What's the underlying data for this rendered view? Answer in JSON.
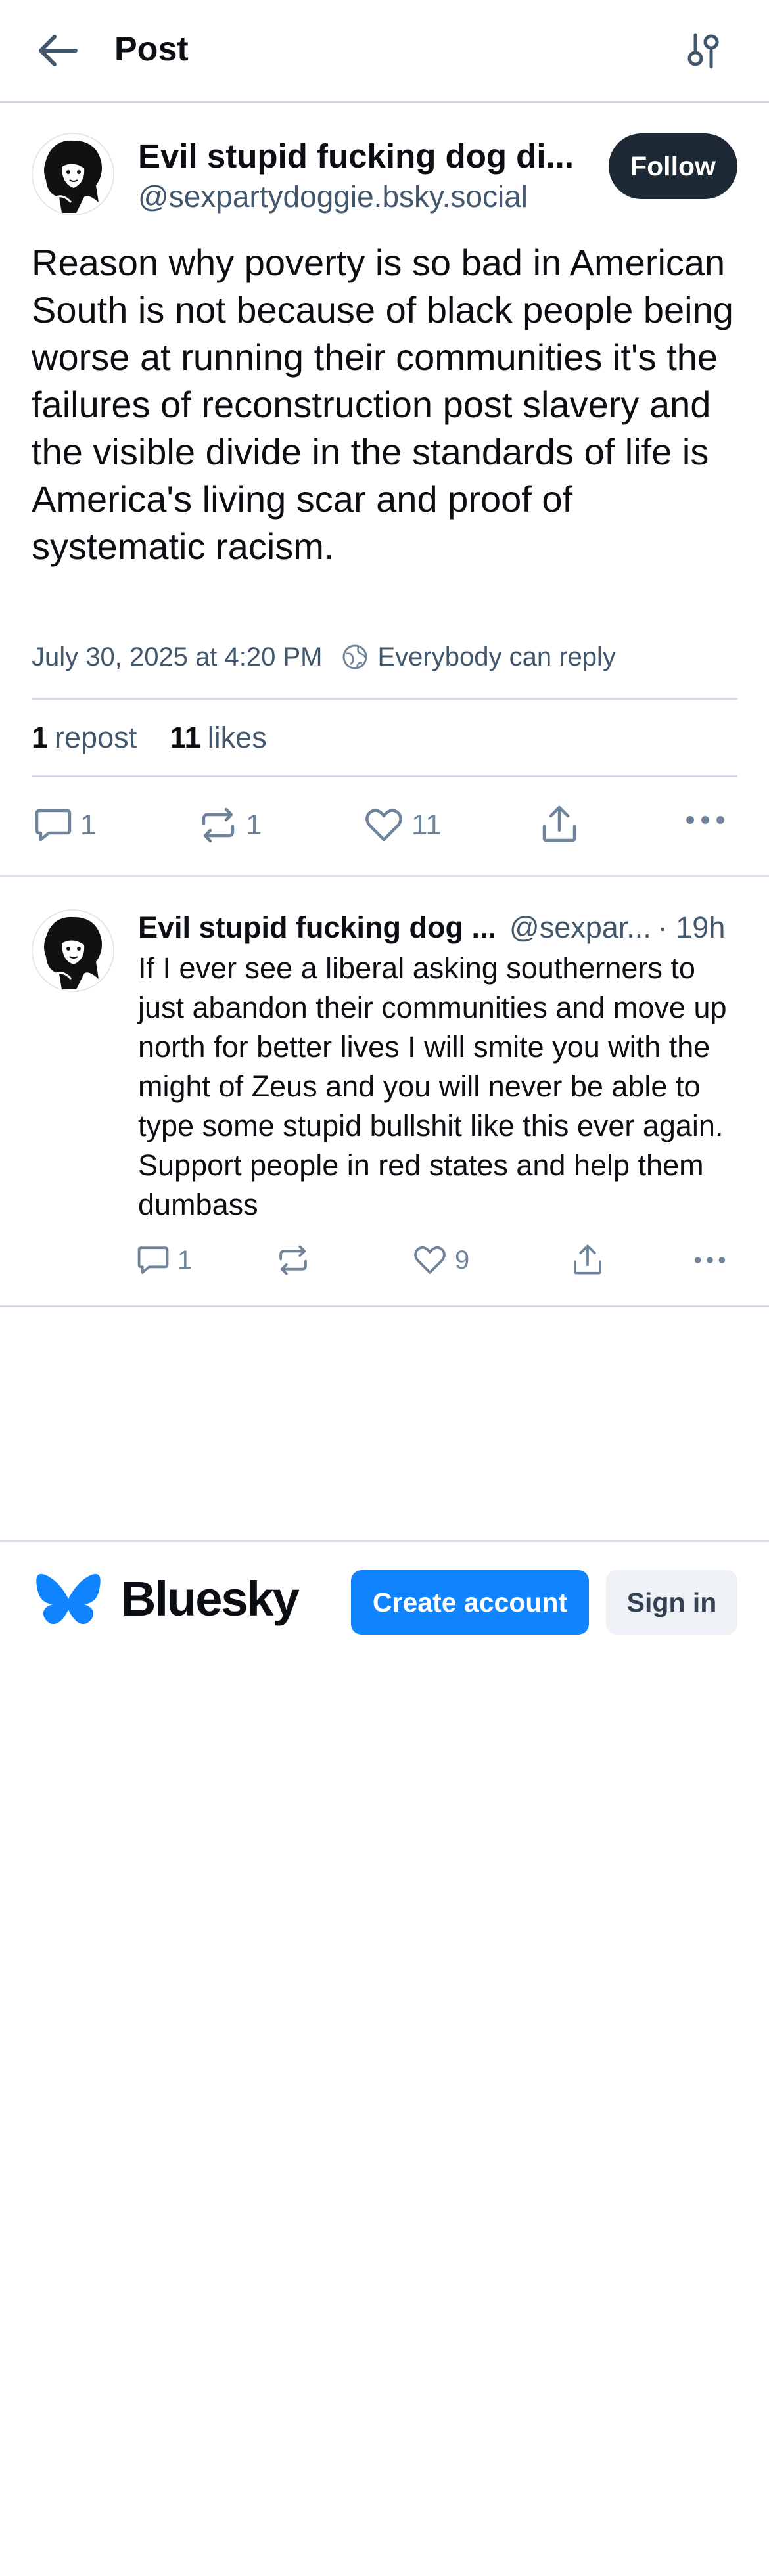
{
  "header": {
    "title": "Post",
    "back_icon": "arrow-left-icon",
    "filter_icon": "sliders-icon"
  },
  "post": {
    "author_name": "Evil stupid fucking dog di...",
    "author_handle": "@sexpartydoggie.bsky.social",
    "follow_label": "Follow",
    "text": "Reason why poverty is so bad in American South is not because of black people being worse at running their communities it's the failures of reconstruction post slavery and the visible divide in the standards of life is America's living scar and proof of systematic racism.",
    "timestamp": "July 30, 2025 at 4:20 PM",
    "reply_setting": "Everybody can reply",
    "reposts_count": "1",
    "reposts_label": "repost",
    "likes_count": "11",
    "likes_label": "likes",
    "actions": {
      "replies": "1",
      "reposts": "1",
      "likes": "11"
    }
  },
  "reply": {
    "author_name": "Evil stupid fucking dog ...",
    "author_handle": "@sexpar...",
    "time": "· 19h",
    "text": "If I ever see a liberal asking southerners to just abandon their communities and move up north for better lives I will smite you with the might of Zeus and you will never be able to type some stupid bullshit like this ever again. Support people in red states and help them dumbass",
    "actions": {
      "replies": "1",
      "reposts": "",
      "likes": "9"
    }
  },
  "footer": {
    "brand": "Bluesky",
    "create_account_label": "Create account",
    "sign_in_label": "Sign in"
  },
  "colors": {
    "accent": "#1083fe",
    "follow_bg": "#1e2936",
    "muted_text": "#42576c",
    "icon_gray": "#6f839a",
    "divider": "#d4dbe2"
  }
}
